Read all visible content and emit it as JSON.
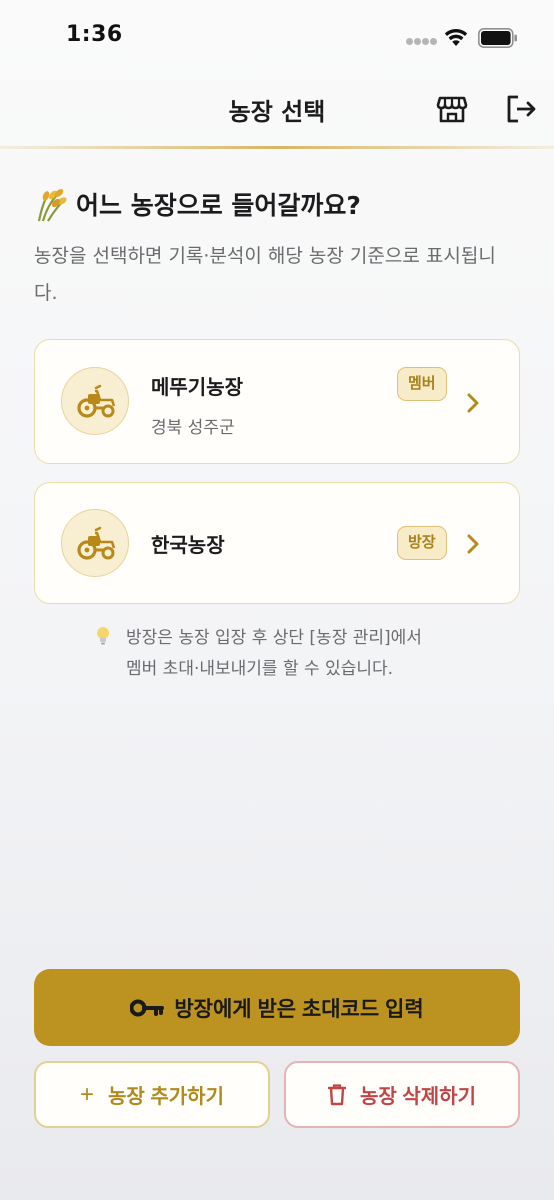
{
  "status": {
    "time": "1:36"
  },
  "nav": {
    "title": "농장 선택",
    "store_icon": "store-icon",
    "logout_icon": "logout-icon"
  },
  "header": {
    "emoji_icon": "rice-plant-icon",
    "heading": "어느 농장으로 들어갈까요?",
    "subtitle": "농장을 선택하면 기록·분석이 해당 농장 기준으로 표시됩니다."
  },
  "farms": [
    {
      "name": "메뚜기농장",
      "location": "경북 성주군",
      "role": "멤버"
    },
    {
      "name": "한국농장",
      "location": "",
      "role": "방장"
    }
  ],
  "tip": {
    "icon": "lightbulb-icon",
    "line1": "방장은 농장 입장 후 상단 [농장 관리]에서",
    "line2": "멤버 초대·내보내기를 할 수 있습니다."
  },
  "actions": {
    "invite_code": "방장에게 받은 초대코드 입력",
    "add_farm": "농장 추가하기",
    "delete_farm": "농장 삭제하기"
  },
  "colors": {
    "accent": "#bc9320",
    "badge_bg": "#f8ebc8",
    "danger": "#c24545"
  }
}
